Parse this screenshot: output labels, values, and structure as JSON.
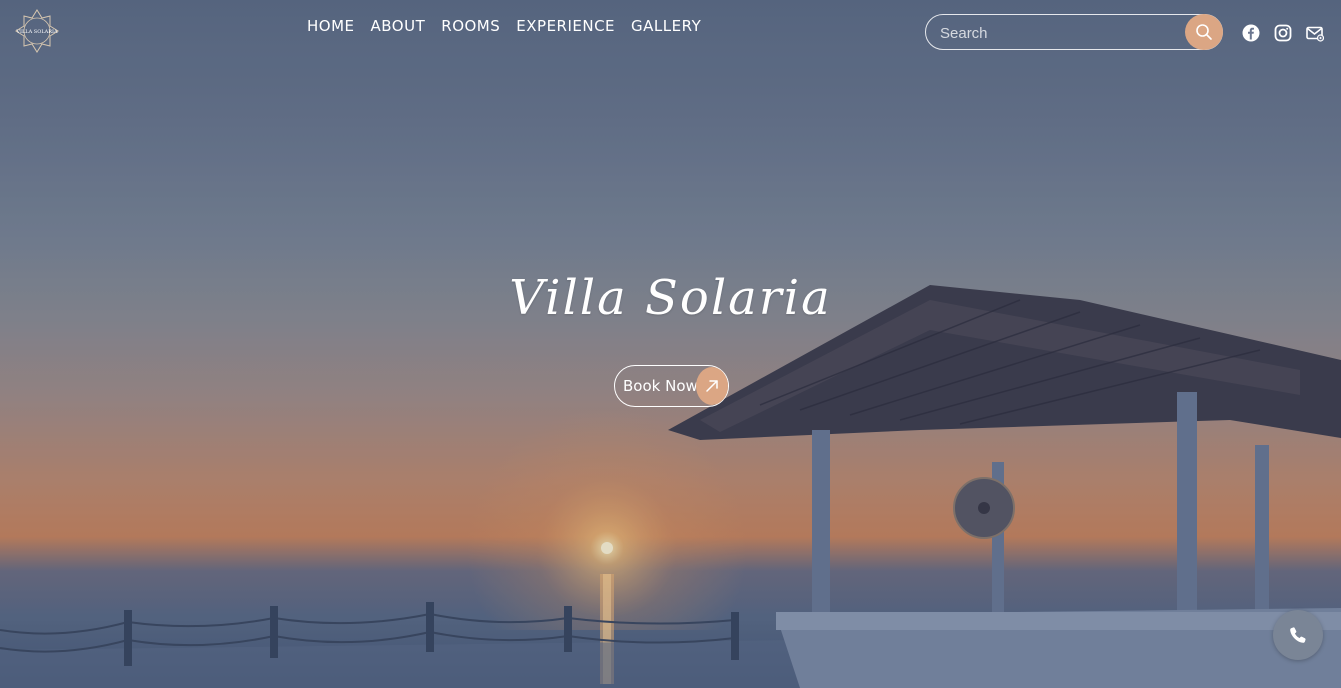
{
  "header": {
    "logo_alt": "VILLA SOLARIA",
    "nav": [
      {
        "label": "HOME"
      },
      {
        "label": "ABOUT"
      },
      {
        "label": "ROOMS"
      },
      {
        "label": "EXPERIENCE"
      },
      {
        "label": "GALLERY"
      }
    ],
    "search": {
      "placeholder": "Search",
      "value": "",
      "icon": "search-icon"
    },
    "social": [
      {
        "icon": "facebook-icon"
      },
      {
        "icon": "instagram-icon"
      },
      {
        "icon": "email-icon"
      }
    ]
  },
  "hero": {
    "title": "Villa Solaria",
    "book_label": "Book Now",
    "book_icon": "arrow-up-right-icon"
  },
  "floating": {
    "phone_icon": "phone-icon"
  },
  "colors": {
    "accent": "#dba684",
    "text": "#ffffff",
    "phone_bg": "#7a8596"
  }
}
